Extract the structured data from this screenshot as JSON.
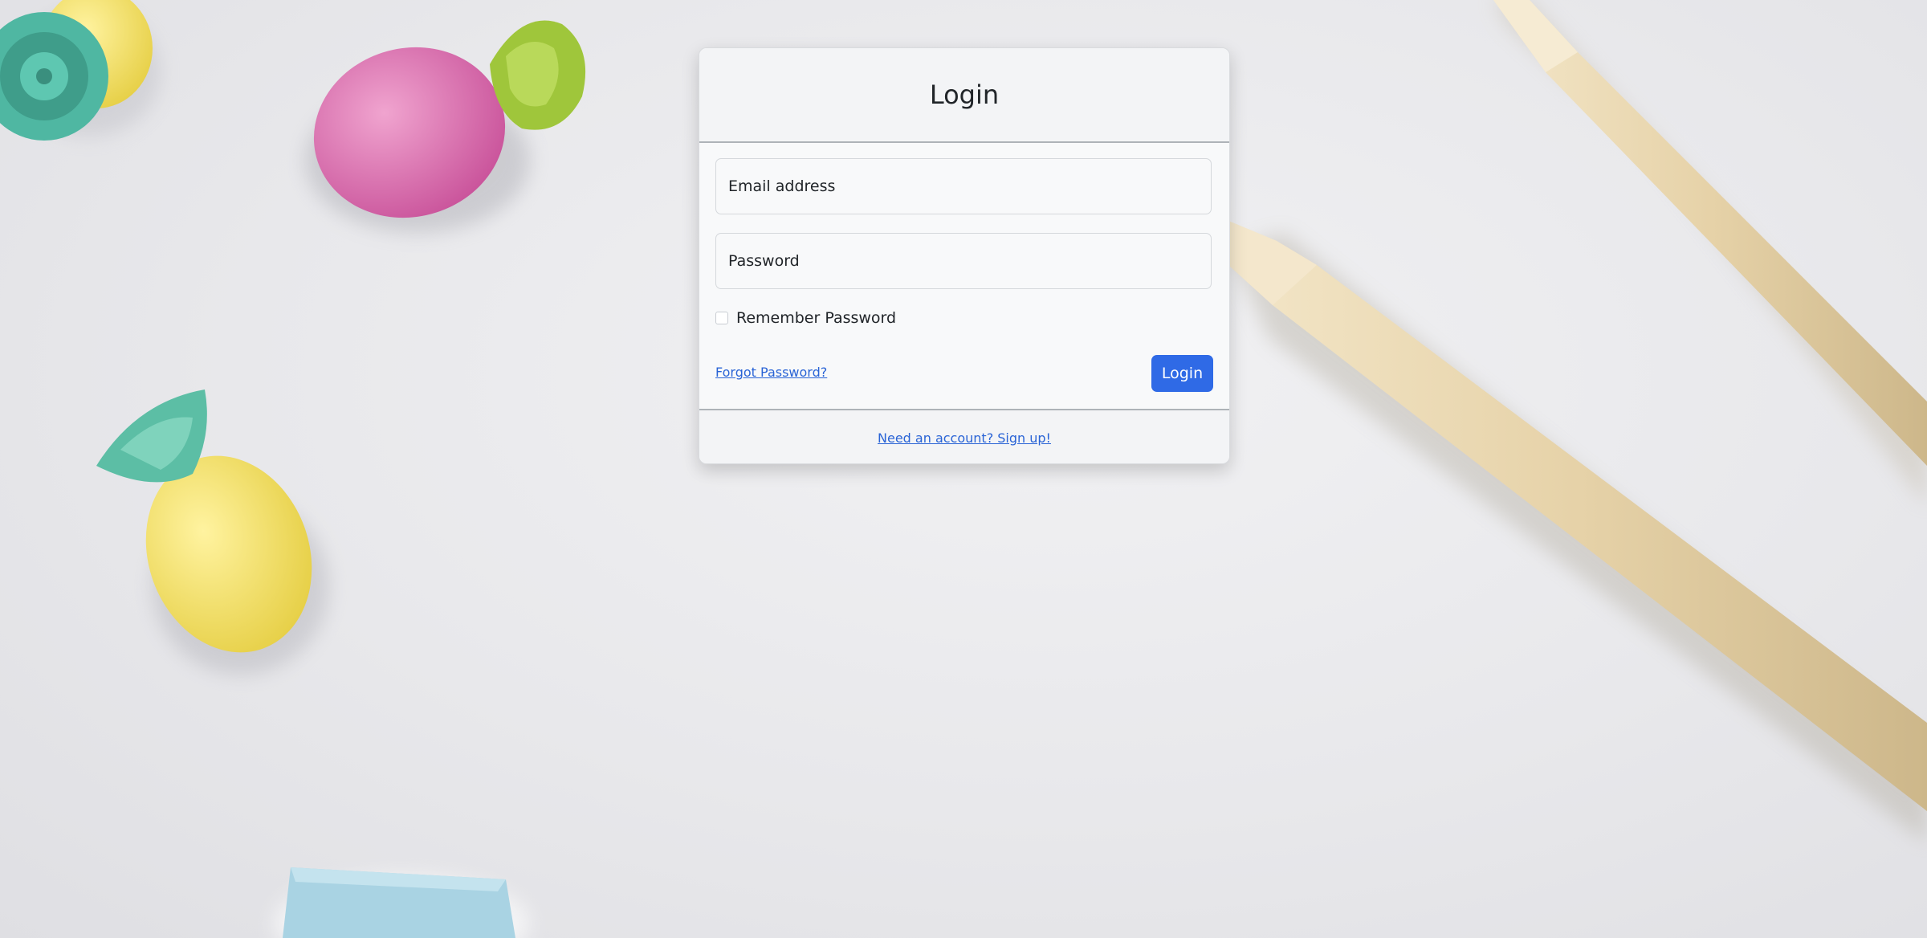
{
  "login_card": {
    "title": "Login",
    "email_placeholder": "Email address",
    "password_placeholder": "Password",
    "remember_label": "Remember Password",
    "remember_checked": false,
    "forgot_link": "Forgot Password?",
    "submit_label": "Login",
    "signup_link": "Need an account? Sign up!"
  },
  "colors": {
    "primary_button": "#2f6ae6",
    "link": "#2a64d6",
    "card_background": "#f8f9fa"
  }
}
